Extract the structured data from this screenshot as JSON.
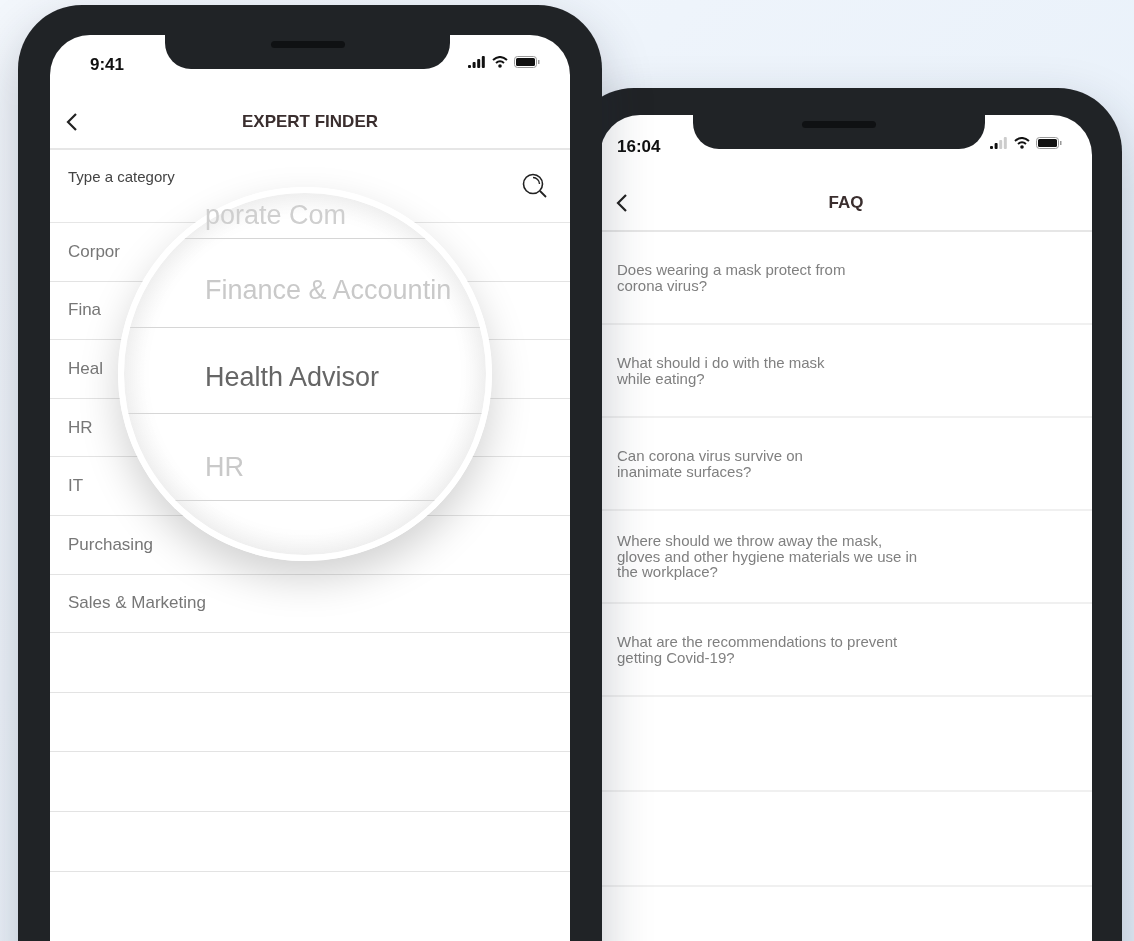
{
  "expert_finder": {
    "status_time": "9:41",
    "title": "EXPERT FINDER",
    "search": {
      "placeholder": "Type a category"
    },
    "items": [
      "Corpor",
      "Fina",
      "Heal",
      "HR",
      "IT",
      "Purchasing",
      "Sales & Marketing"
    ],
    "magnifier": {
      "top_text": "porate Com",
      "items": [
        {
          "label": "Finance & Accountin",
          "selected": false
        },
        {
          "label": "Health Advisor",
          "selected": true
        },
        {
          "label": "HR",
          "selected": false
        }
      ]
    }
  },
  "faq": {
    "status_time": "16:04",
    "title": "FAQ",
    "questions": [
      "Does wearing a mask protect from\ncorona virus?",
      "What should i do with the mask\nwhile eating?",
      "Can corona virus survive on\ninanimate surfaces?",
      "Where should we throw away the mask,\ngloves and other hygiene materials we use in\nthe workplace?",
      "What are the recommendations to prevent\ngetting Covid-19?"
    ]
  }
}
